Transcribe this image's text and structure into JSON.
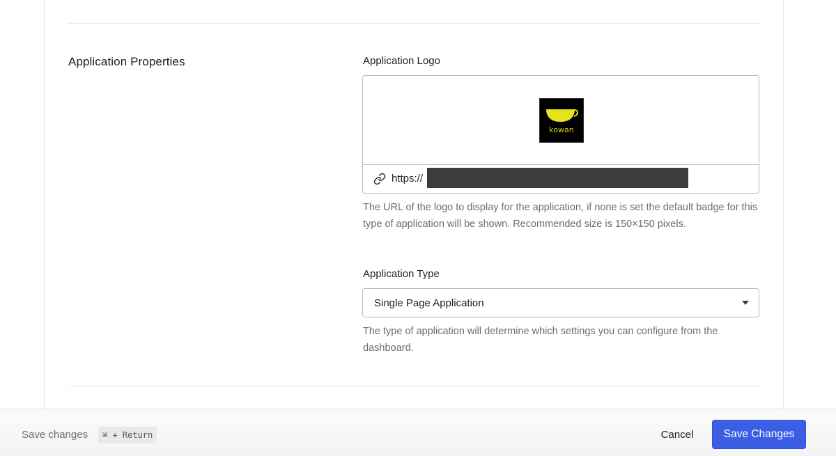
{
  "section": {
    "title": "Application Properties"
  },
  "logo_field": {
    "label": "Application Logo",
    "logo_text": "kowan",
    "url_prefix": "https://",
    "help": "The URL of the logo to display for the application, if none is set the default badge for this type of application will be shown. Recommended size is 150×150 pixels."
  },
  "type_field": {
    "label": "Application Type",
    "value": "Single Page Application",
    "help": "The type of application will determine which settings you can configure from the dashboard."
  },
  "footer": {
    "hint": "Save changes",
    "shortcut": "⌘ + Return",
    "cancel_label": "Cancel",
    "save_label": "Save Changes"
  },
  "colors": {
    "primary_button": "#3b5ee5",
    "logo_accent": "#e8e21a"
  },
  "icons": {
    "url_field": "link-icon",
    "select": "caret-down-icon"
  }
}
